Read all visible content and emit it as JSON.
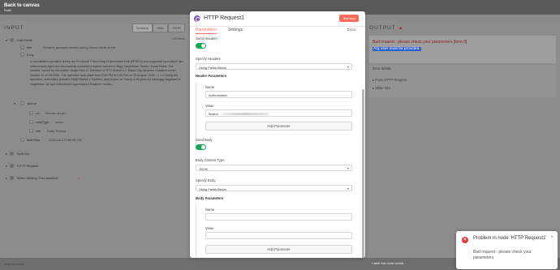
{
  "topbar": {
    "back_label": "Back to canvas",
    "sub_label": "Fbath"
  },
  "input": {
    "title": "INPUT",
    "view_tabs": [
      "Schema",
      "Table",
      "JSON"
    ],
    "items_count": "100 items",
    "tree": {
      "edit_fields": "Edit Fields",
      "title_key": "title",
      "title_value": "Firearm, grenade seized during Ilocos Norte arrest",
      "body_key": "body",
      "body_value": "A coordinated operation led by the Provincial Police Drug Enforcement Unit (PPDEU) and supported by multiple law enforcement agencies successfully executed a search warrant in Brgy. Nagrebcan, Badoc, Ilocos Norte. The warrant, issued by Honorable Judge Felix G. Salvador of RTC Branch 17, Batac City, targeted violations under Section 11 of RA 9165. The operation took place from 5:00 PM to 9:30 PM on 20 August, 2024. \\ r \\ n During the operation, authorities arrested Hadji Palafox y Factoen, also known as Sokoy, a 46-year-old barangay kagawad of Nagrebcan. As law enforcement approached Palafox's reside...",
      "source_key": "source",
      "url_key": "url",
      "url_value": "tribune.net.ph",
      "datatype_key": "dataType",
      "datatype_value": "news",
      "src_title_key": "title",
      "src_title_value": "Daily Tribune",
      "datetime_key": "dateTime",
      "datetime_value": "2024-08-21T06:55:13Z",
      "split_out": "Split Out",
      "http_request": "HTTP Request",
      "trigger": "When clicking 'Test workflow'"
    }
  },
  "modal": {
    "title": "HTTP Request1",
    "test_button": "Test step",
    "tabs": [
      "Parameters",
      "Settings"
    ],
    "docs": "Docs",
    "send_headers_label": "Send Headers",
    "specify_headers_label": "Specify Headers",
    "specify_headers_value": "Using Fields Below",
    "header_params_label": "Header Parameters",
    "name_label": "Name",
    "name_value": "Authorization",
    "value_label": "Value",
    "value_value": "Bearer",
    "add_param_label": "Add Parameter",
    "send_body_label": "Send Body",
    "body_content_type_label": "Body Content Type",
    "body_content_type_value": "JSON",
    "specify_body_label": "Specify Body",
    "specify_body_value": "Using Fields Below",
    "body_params_label": "Body Parameters",
    "body_name_label": "Name",
    "body_value_label": "Value",
    "add_param_label_2": "Add Parameter"
  },
  "output": {
    "title": "OUTPUT",
    "error_main": "Bad request - please check your parameters [item 0]",
    "error_sub": "Arg user must be provided.",
    "details_title": "Error details",
    "from_http": "From HTTP Request",
    "other_info": "Other info"
  },
  "bottom": {
    "left_label": "Ask Assistant",
    "mid_label": "I wish this node would..."
  },
  "toast": {
    "title": "Problem in node 'HTTP Request1'",
    "message": "Bad request - please check your parameters"
  },
  "colors": {
    "accent": "#ff6d5a",
    "toggle_on": "#13a855",
    "error": "#e03b3b"
  }
}
